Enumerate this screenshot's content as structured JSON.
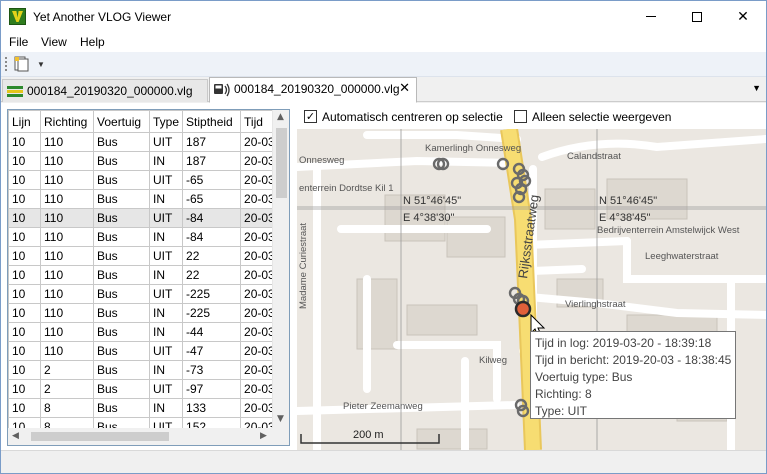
{
  "window": {
    "title": "Yet Another VLOG Viewer"
  },
  "menu": [
    {
      "label": "File"
    },
    {
      "label": "View"
    },
    {
      "label": "Help"
    }
  ],
  "tabs": [
    {
      "label": "000184_20190320_000000.vlg",
      "active": false
    },
    {
      "label": "000184_20190320_000000.vlg",
      "active": true
    }
  ],
  "options": {
    "auto_center": {
      "label": "Automatisch centreren op selectie",
      "checked": true
    },
    "only_selection": {
      "label": "Alleen selectie weergeven",
      "checked": false
    }
  },
  "table": {
    "columns": [
      "Lijn",
      "Richting",
      "Voertuig",
      "Type",
      "Stiptheid",
      "Tijd"
    ],
    "rows": [
      [
        "10",
        "110",
        "Bus",
        "UIT",
        "187",
        "20-03"
      ],
      [
        "10",
        "110",
        "Bus",
        "IN",
        "187",
        "20-03"
      ],
      [
        "10",
        "110",
        "Bus",
        "UIT",
        "-65",
        "20-03"
      ],
      [
        "10",
        "110",
        "Bus",
        "IN",
        "-65",
        "20-03"
      ],
      [
        "10",
        "110",
        "Bus",
        "UIT",
        "-84",
        "20-03"
      ],
      [
        "10",
        "110",
        "Bus",
        "IN",
        "-84",
        "20-03"
      ],
      [
        "10",
        "110",
        "Bus",
        "UIT",
        "22",
        "20-03"
      ],
      [
        "10",
        "110",
        "Bus",
        "IN",
        "22",
        "20-03"
      ],
      [
        "10",
        "110",
        "Bus",
        "UIT",
        "-225",
        "20-03"
      ],
      [
        "10",
        "110",
        "Bus",
        "IN",
        "-225",
        "20-03"
      ],
      [
        "10",
        "110",
        "Bus",
        "IN",
        "-44",
        "20-03"
      ],
      [
        "10",
        "110",
        "Bus",
        "UIT",
        "-47",
        "20-03"
      ],
      [
        "10",
        "2",
        "Bus",
        "IN",
        "-73",
        "20-03"
      ],
      [
        "10",
        "2",
        "Bus",
        "UIT",
        "-97",
        "20-03"
      ],
      [
        "10",
        "8",
        "Bus",
        "IN",
        "133",
        "20-03"
      ],
      [
        "10",
        "8",
        "Bus",
        "UIT",
        "152",
        "20-03"
      ]
    ],
    "selected_row": 4
  },
  "map": {
    "streets": [
      "Kamerlingh Onnesweg",
      "Onnesweg",
      "Calandstraat",
      "enterrein Dordtse Kil 1",
      "Madame Curiestraat",
      "Rijksstraatweg",
      "Bedrijventerrein Amstelwijck West",
      "Leeghwaterstraat",
      "Vierlinghstraat",
      "Kilweg",
      "Pieter Zeemanweg"
    ],
    "coords": [
      {
        "lat": "N 51°46'45\"",
        "lon": "E 4°38'30\""
      },
      {
        "lat": "N 51°46'45\"",
        "lon": "E 4°38'45\""
      }
    ],
    "scale_label": "200 m"
  },
  "tooltip": {
    "lines": [
      "Tijd in log: 2019-03-20 - 18:39:18",
      "Tijd in bericht: 2019-20-03 - 18:38:45",
      "Voertuig type: Bus",
      "Richting: 8",
      "Type: UIT"
    ]
  },
  "colors": {
    "road_main": "#f7dd72",
    "road_minor": "#ffffff",
    "background": "#ebe7e1",
    "selected_marker": "#e0603a"
  },
  "icons": {
    "app": "vlog-app-icon",
    "toolbar": "open-file-icon",
    "tab_inactive": "grid-icon",
    "tab_active": "map-bus-icon"
  }
}
